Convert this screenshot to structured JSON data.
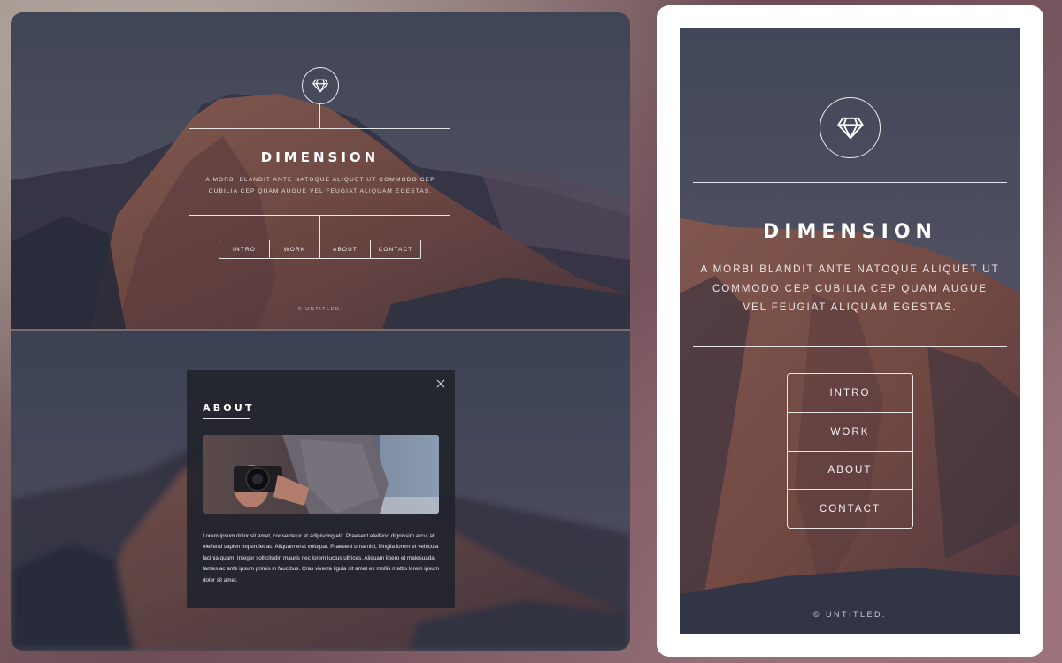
{
  "site": {
    "title": "DIMENSION",
    "subtitle": "A MORBI BLANDIT ANTE NATOQUE ALIQUET UT COMMODO CEP CUBILIA CEP QUAM AUGUE VEL FEUGIAT ALIQUAM EGESTAS.",
    "logo_icon": "diamond-icon",
    "footer": "© UNTITLED."
  },
  "nav": {
    "items": [
      "INTRO",
      "WORK",
      "ABOUT",
      "CONTACT"
    ]
  },
  "modal": {
    "title": "ABOUT",
    "close_icon": "close-icon",
    "body": "Lorem ipsum dolor sit amet, consectetur et adipiscing elit. Praesent eleifend dignissim arcu, at eleifend sapien imperdiet ac. Aliquam erat volutpat. Praesent urna nisi, fringila lorem et vehicula lacinia quam. Integer sollicitudin mauris nec lorem luctus ultrices. Aliquam libero et malesuada fames ac ante ipsum primis in faucibus. Cras viverra ligula sit amet ex mollis mattis lorem ipsum dolor sit amet."
  },
  "colors": {
    "sky": "#5a6070",
    "rock": "#8e5a50",
    "overlay": "#22242c"
  }
}
